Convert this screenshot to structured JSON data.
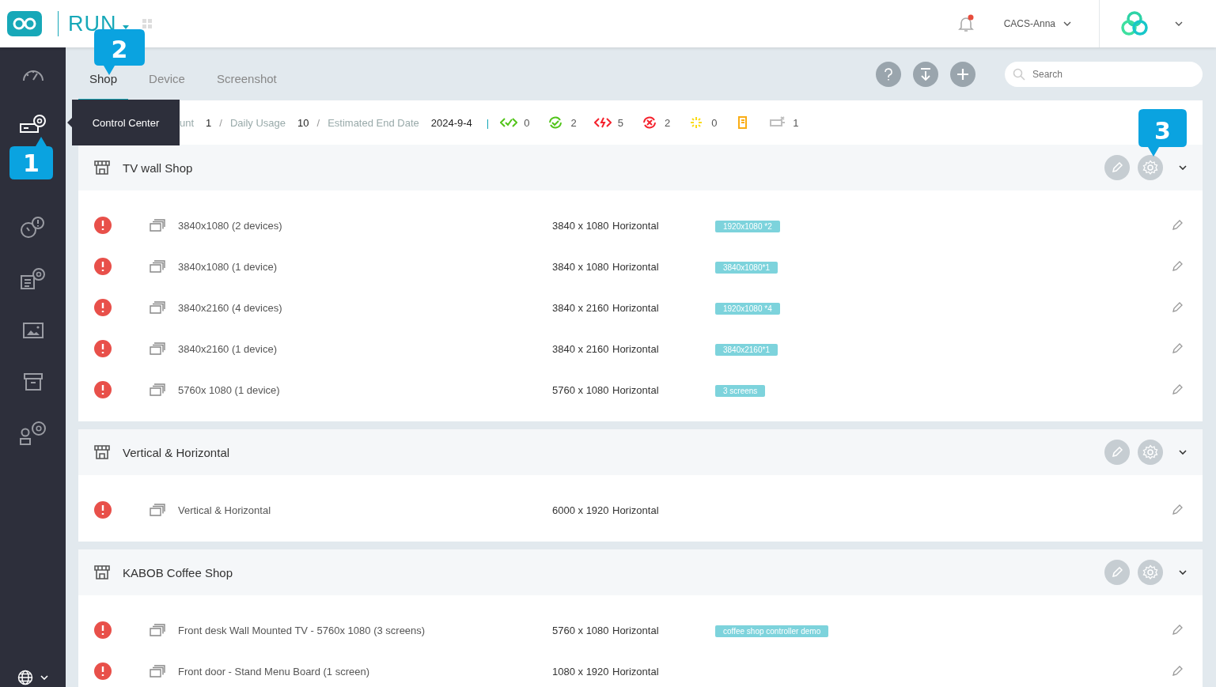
{
  "header": {
    "app_name": "RUN",
    "user": "CACS-Anna",
    "notification_unread": true
  },
  "sidebar": {
    "items": [
      {
        "kind": "dashboard",
        "selected": false
      },
      {
        "kind": "control",
        "selected": true
      },
      {
        "kind": "alert",
        "selected": false
      },
      {
        "kind": "docgear",
        "selected": false
      },
      {
        "kind": "image",
        "selected": false
      },
      {
        "kind": "archive",
        "selected": false
      },
      {
        "kind": "usergear",
        "selected": false
      }
    ],
    "tooltip": "Control Center"
  },
  "tabs": [
    {
      "label": "Shop",
      "selected": true
    },
    {
      "label": "Device",
      "selected": false
    },
    {
      "label": "Screenshot",
      "selected": false
    }
  ],
  "search": {
    "placeholder": "Search"
  },
  "summary": [
    {
      "label": "unt",
      "value": "1",
      "separator": "/"
    },
    {
      "label": "Daily Usage",
      "value": "10",
      "separator": "/"
    },
    {
      "label": "Estimated End Date",
      "value": "2024-9-4"
    }
  ],
  "summary_divider": "|",
  "status_counts": [
    {
      "kind": "online",
      "color": "#52c41a",
      "count": "0"
    },
    {
      "kind": "synced",
      "color": "#52c41a",
      "count": "2"
    },
    {
      "kind": "error",
      "color": "#f5222d",
      "count": "5"
    },
    {
      "kind": "offline",
      "color": "#f5222d",
      "count": "2"
    },
    {
      "kind": "loading",
      "color": "#fadb14",
      "count": "0"
    },
    {
      "kind": "document",
      "color": "#faad14"
    },
    {
      "kind": "disconnected",
      "color": "#bfbfbf",
      "count": "1"
    }
  ],
  "groups": [
    {
      "title": "TV wall Shop",
      "expanded": true,
      "rows": [
        {
          "name": "3840x1080 (2 devices)",
          "resolution": "3840 x 1080",
          "orientation": "Horizontal",
          "tag": "1920x1080 *2"
        },
        {
          "name": "3840x1080 (1 device)",
          "resolution": "3840 x 1080",
          "orientation": "Horizontal",
          "tag": "3840x1080*1"
        },
        {
          "name": "3840x2160 (4 devices)",
          "resolution": "3840 x 2160",
          "orientation": "Horizontal",
          "tag": "1920x1080 *4"
        },
        {
          "name": "3840x2160 (1 device)",
          "resolution": "3840 x 2160",
          "orientation": "Horizontal",
          "tag": "3840x2160*1"
        },
        {
          "name": "5760x 1080 (1 device)",
          "resolution": "5760 x 1080",
          "orientation": "Horizontal",
          "tag": "3 screens"
        }
      ]
    },
    {
      "title": "Vertical & Horizontal",
      "expanded": true,
      "rows": [
        {
          "name": "Vertical & Horizontal",
          "resolution": "6000 x 1920",
          "orientation": "Horizontal"
        }
      ]
    },
    {
      "title": "KABOB Coffee Shop",
      "expanded": true,
      "rows": [
        {
          "name": "Front desk Wall Mounted TV - 5760x 1080 (3 screens)",
          "resolution": "5760 x 1080",
          "orientation": "Horizontal",
          "tag": "coffee shop controller demo"
        },
        {
          "name": "Front door - Stand Menu Board (1 screen)",
          "resolution": "1080 x 1920",
          "orientation": "Horizontal"
        }
      ]
    }
  ],
  "callouts": [
    {
      "number": "1"
    },
    {
      "number": "2"
    },
    {
      "number": "3"
    }
  ]
}
